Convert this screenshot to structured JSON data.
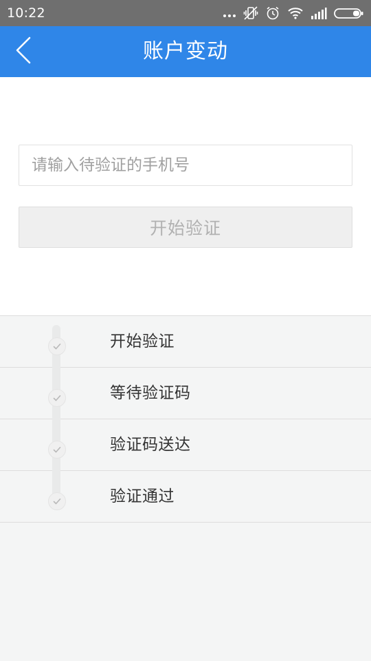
{
  "status_bar": {
    "time": "10:22",
    "icons": [
      "more-dots-icon",
      "vibrate-off-icon",
      "alarm-icon",
      "wifi-icon",
      "signal-icon",
      "battery-icon"
    ]
  },
  "header": {
    "title": "账户变动",
    "back_icon": "chevron-left-icon",
    "background_color": "#2f86e8"
  },
  "form": {
    "phone_placeholder": "请输入待验证的手机号",
    "phone_value": "",
    "start_button_label": "开始验证"
  },
  "steps": [
    {
      "label": "开始验证",
      "icon": "check-icon"
    },
    {
      "label": "等待验证码",
      "icon": "check-icon"
    },
    {
      "label": "验证码送达",
      "icon": "check-icon"
    },
    {
      "label": "验证通过",
      "icon": "check-icon"
    }
  ]
}
